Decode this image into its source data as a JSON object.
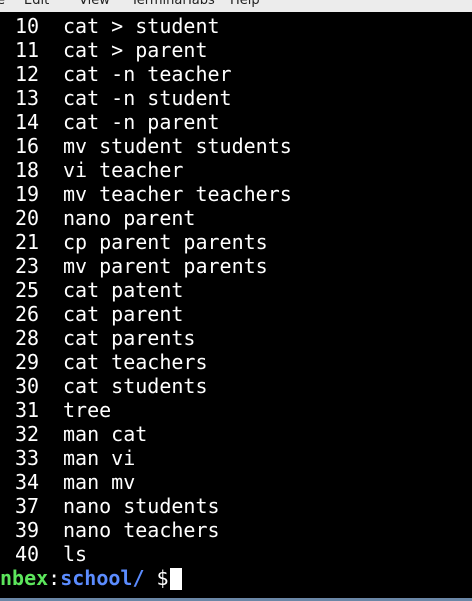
{
  "menubar": {
    "items": [
      "e",
      "Edit",
      "View",
      "Terminal",
      "Tabs",
      "Help"
    ]
  },
  "history": [
    {
      "num": "10",
      "cmd": "cat > student"
    },
    {
      "num": "11",
      "cmd": "cat > parent"
    },
    {
      "num": "12",
      "cmd": "cat -n teacher"
    },
    {
      "num": "13",
      "cmd": "cat -n student"
    },
    {
      "num": "14",
      "cmd": "cat -n parent"
    },
    {
      "num": "16",
      "cmd": "mv student students"
    },
    {
      "num": "18",
      "cmd": "vi teacher"
    },
    {
      "num": "19",
      "cmd": "mv teacher teachers"
    },
    {
      "num": "20",
      "cmd": "nano parent"
    },
    {
      "num": "21",
      "cmd": "cp parent parents"
    },
    {
      "num": "23",
      "cmd": "mv parent parents"
    },
    {
      "num": "25",
      "cmd": "cat patent"
    },
    {
      "num": "26",
      "cmd": "cat parent"
    },
    {
      "num": "28",
      "cmd": "cat parents"
    },
    {
      "num": "29",
      "cmd": "cat teachers"
    },
    {
      "num": "30",
      "cmd": "cat students"
    },
    {
      "num": "31",
      "cmd": "tree"
    },
    {
      "num": "32",
      "cmd": "man cat"
    },
    {
      "num": "33",
      "cmd": "man vi"
    },
    {
      "num": "34",
      "cmd": "man mv"
    },
    {
      "num": "37",
      "cmd": "nano students"
    },
    {
      "num": "39",
      "cmd": "nano teachers"
    },
    {
      "num": "40",
      "cmd": "ls"
    }
  ],
  "prompt": {
    "host": "nbex",
    "separator": ":",
    "path": "school/",
    "symbol": " $ "
  },
  "colors": {
    "background": "#000000",
    "text": "#ffffff",
    "host": "#5ce65c",
    "path": "#5b8cff"
  }
}
